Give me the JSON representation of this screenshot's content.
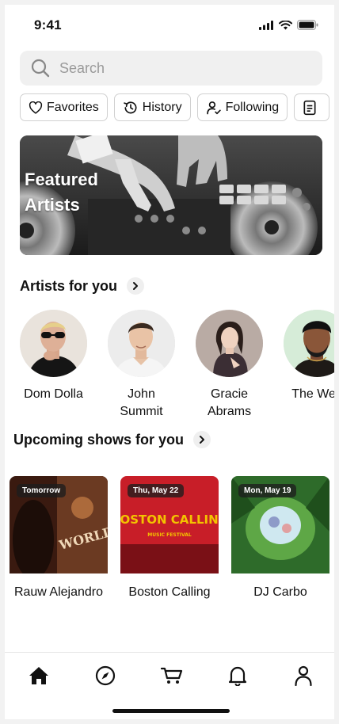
{
  "status_bar": {
    "time": "9:41"
  },
  "search": {
    "placeholder": "Search"
  },
  "chips": [
    {
      "label": "Favorites",
      "icon": "heart-icon"
    },
    {
      "label": "History",
      "icon": "history-icon"
    },
    {
      "label": "Following",
      "icon": "user-check-icon"
    },
    {
      "label": "",
      "icon": "document-icon"
    }
  ],
  "featured": {
    "title": "Featured Artists"
  },
  "artists_section": {
    "title": "Artists for you"
  },
  "artists": [
    {
      "name": "Dom Dolla"
    },
    {
      "name": "John Summit"
    },
    {
      "name": "Gracie Abrams"
    },
    {
      "name": "The Wee"
    }
  ],
  "shows_section": {
    "title": "Upcoming shows for you"
  },
  "shows": [
    {
      "badge": "Tomorrow",
      "name": "Rauw Alejandro",
      "poster_text": "WORLD"
    },
    {
      "badge": "Thu, May 22",
      "name": "Boston Calling",
      "poster_text": "BOSTON CALLING",
      "poster_subtext": "MUSIC FESTIVAL"
    },
    {
      "badge": "Mon, May 19",
      "name": "DJ Carbo"
    }
  ],
  "tabs": [
    {
      "icon": "home-icon"
    },
    {
      "icon": "compass-icon"
    },
    {
      "icon": "cart-icon"
    },
    {
      "icon": "bell-icon"
    },
    {
      "icon": "profile-icon"
    }
  ],
  "colors": {
    "accent": "#111111",
    "search_bg": "#f0f0f0",
    "boston_red": "#c81e28",
    "boston_yellow": "#f3c400"
  }
}
